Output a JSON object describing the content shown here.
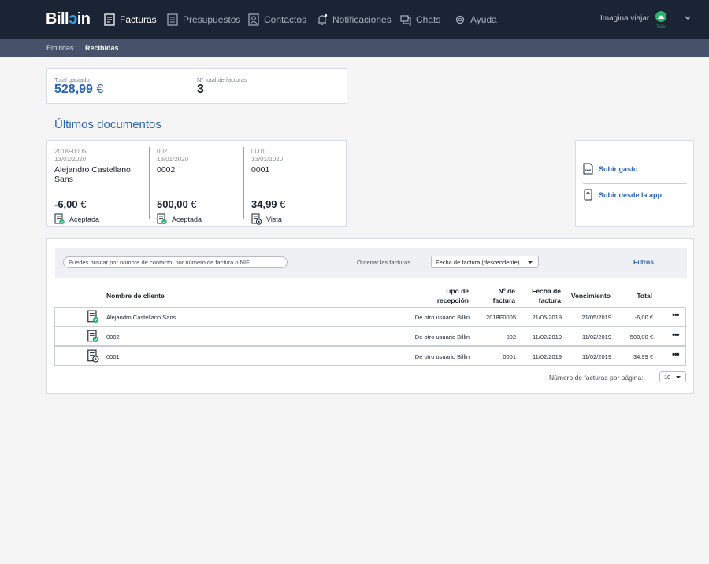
{
  "brand": {
    "name_a": "Bill",
    "name_b": "in"
  },
  "nav": {
    "items": [
      {
        "label": "Facturas",
        "icon": "invoice-icon",
        "active": true
      },
      {
        "label": "Presupuestos",
        "icon": "budget-icon",
        "active": false
      },
      {
        "label": "Contactos",
        "icon": "contacts-icon",
        "active": false
      },
      {
        "label": "Notificaciones",
        "icon": "bell-icon",
        "active": false
      },
      {
        "label": "Chats",
        "icon": "chat-icon",
        "active": false
      },
      {
        "label": "Ayuda",
        "icon": "help-icon",
        "active": false
      }
    ],
    "user_name": "Imagina viajar",
    "avatar_text": "ToGo"
  },
  "subnav": {
    "items": [
      "Emitidas",
      "Recibidas"
    ],
    "active": "Recibidas"
  },
  "stats": {
    "total_label": "Total gastado",
    "total_value": "528,99",
    "total_currency": "€",
    "count_label": "Nº total de facturas",
    "count_value": "3"
  },
  "recent": {
    "title": "Últimos documentos",
    "docs": [
      {
        "number": "2018F0005",
        "date": "13/01/2020",
        "name": "Alejandro Castellano Sans",
        "amount": "-6,00",
        "currency": "€",
        "status": "Aceptada",
        "status_icon": "accepted-icon"
      },
      {
        "number": "002",
        "date": "13/01/2020",
        "name": "0002",
        "amount": "500,00",
        "currency": "€",
        "status": "Aceptada",
        "status_icon": "accepted-icon"
      },
      {
        "number": "0001",
        "date": "13/01/2020",
        "name": "0001",
        "amount": "34,99",
        "currency": "€",
        "status": "Vista",
        "status_icon": "viewed-icon"
      }
    ]
  },
  "upload": {
    "expense": "Subir gasto",
    "app": "Subir desde la app"
  },
  "filters": {
    "search_placeholder": "Puedes buscar por nombre de contacto, por número de factura o NIF",
    "order_label": "Ordenar las facturas",
    "order_value": "Fecha de factura (descendente)",
    "filters_link": "Filtros"
  },
  "table": {
    "headers": {
      "client": "Nombre de cliente",
      "reception_1": "Tipo de",
      "reception_2": "recepción",
      "number_1": "Nº de",
      "number_2": "factura",
      "date_1": "Fecha de",
      "date_2": "factura",
      "due": "Vencimiento",
      "total": "Total"
    },
    "rows": [
      {
        "client": "Alejandro Castellano Sans",
        "reception": "De otro usuario Billin",
        "number": "2018F0005",
        "date": "21/05/2019",
        "due": "21/05/2019",
        "total": "-6,00 €",
        "status_icon": "accepted-icon"
      },
      {
        "client": "0002",
        "reception": "De otro usuario Billin",
        "number": "002",
        "date": "11/02/2019",
        "due": "11/02/2019",
        "total": "500,00 €",
        "status_icon": "accepted-icon"
      },
      {
        "client": "0001",
        "reception": "De otro usuario Billin",
        "number": "0001",
        "date": "11/02/2019",
        "due": "11/02/2019",
        "total": "34,99 €",
        "status_icon": "viewed-icon"
      }
    ],
    "more_label": "•••"
  },
  "pagination": {
    "per_page_label": "Número de facturas por página:",
    "per_page_value": "10"
  },
  "colors": {
    "nav_bg": "#1b2434",
    "subnav_bg": "#46526a",
    "accent": "#2c63b6",
    "accepted": "#27b36a",
    "brand_slash": "#35a3e8"
  }
}
